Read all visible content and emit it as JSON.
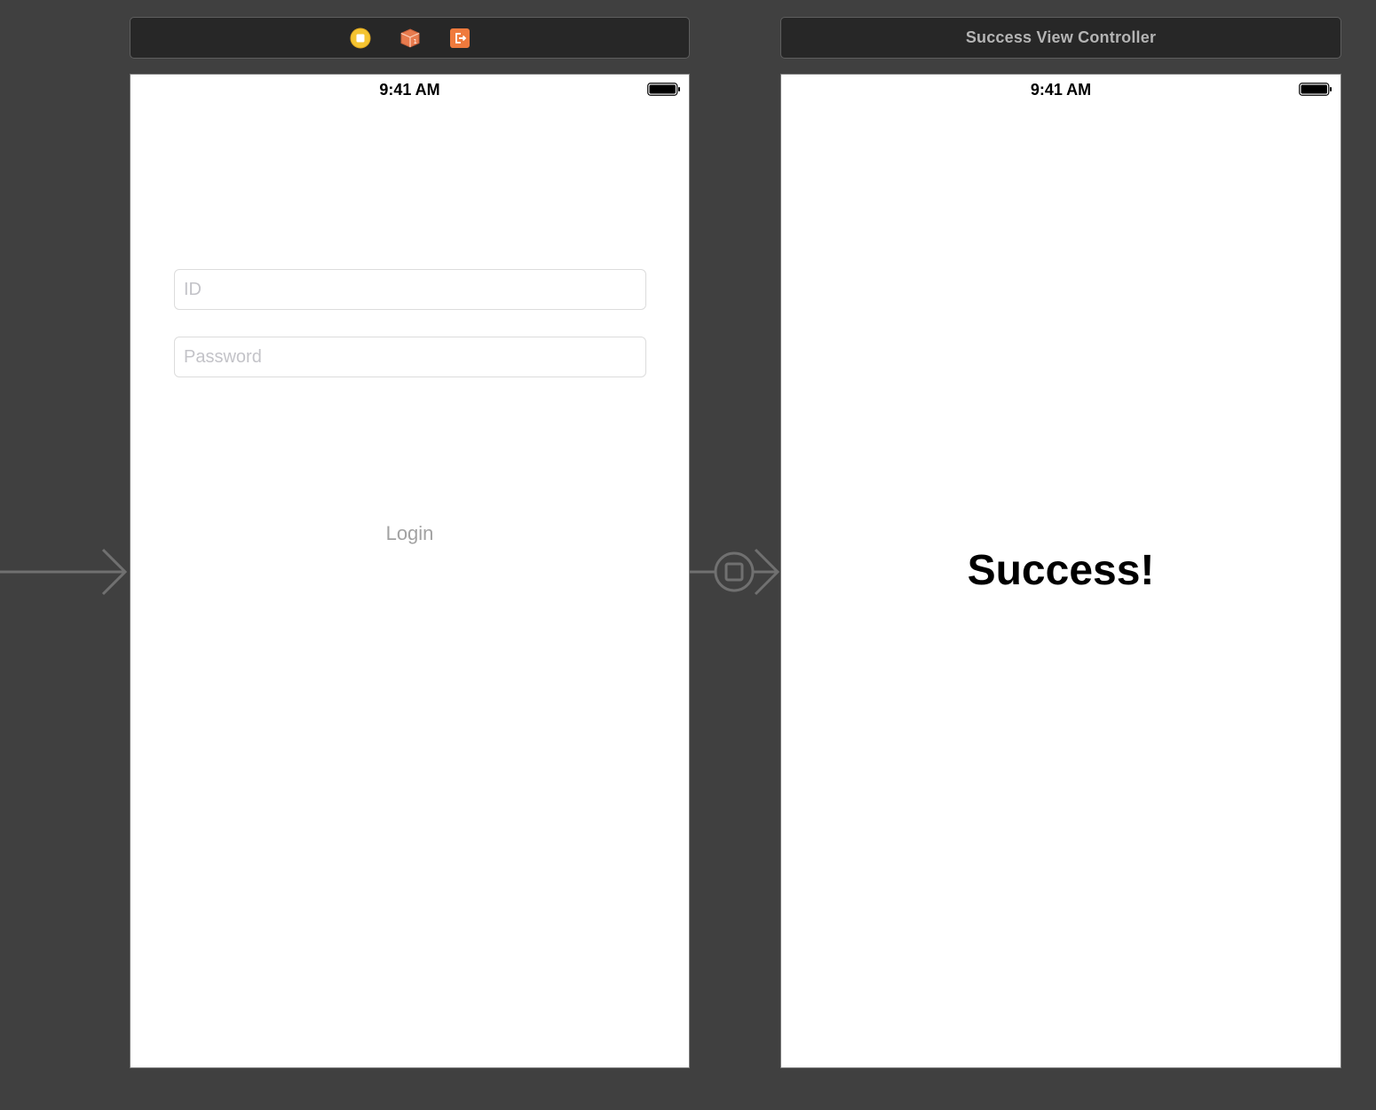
{
  "login_scene": {
    "dock_icons": [
      "view-controller-icon",
      "first-responder-icon",
      "exit-icon"
    ],
    "status_time": "9:41 AM",
    "id_field": {
      "value": "",
      "placeholder": "ID"
    },
    "password_field": {
      "value": "",
      "placeholder": "Password"
    },
    "login_button_label": "Login"
  },
  "success_scene": {
    "title": "Success View Controller",
    "status_time": "9:41 AM",
    "success_label": "Success!"
  },
  "colors": {
    "canvas": "#404040",
    "scene_bar": "#272727",
    "vc_icon": "#f5c431",
    "first_responder_icon": "#e87b4e",
    "exit_icon": "#ef7a3d",
    "connector": "#707070"
  }
}
